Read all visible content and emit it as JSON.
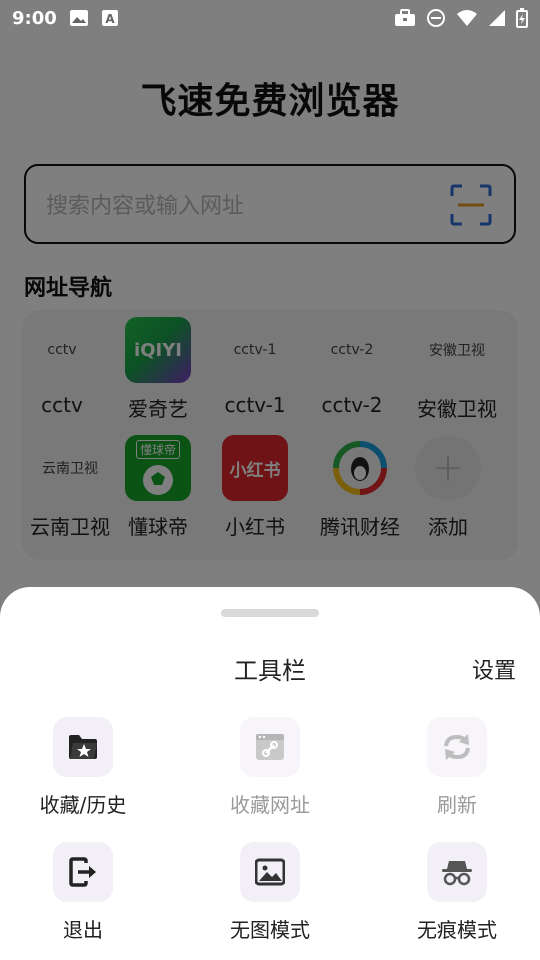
{
  "status_bar": {
    "time": "9:00"
  },
  "app_title": "飞速免费浏览器",
  "search": {
    "placeholder": "搜索内容或输入网址"
  },
  "nav": {
    "heading": "网址导航",
    "items": [
      {
        "label": "cctv",
        "thumb_text": "cctv"
      },
      {
        "label": "爱奇艺",
        "thumb_text": "iQIYI"
      },
      {
        "label": "cctv-1",
        "thumb_text": "cctv-1"
      },
      {
        "label": "cctv-2",
        "thumb_text": "cctv-2"
      },
      {
        "label": "安徽卫视",
        "thumb_text": "安徽卫视"
      },
      {
        "label": "云南卫视",
        "thumb_text": "云南卫视"
      },
      {
        "label": "懂球帝",
        "thumb_text": "懂球帝"
      },
      {
        "label": "小红书",
        "thumb_text": "小红书"
      },
      {
        "label": "腾讯财经",
        "thumb_text": ""
      },
      {
        "label": "添加",
        "thumb_text": "+"
      }
    ]
  },
  "sheet": {
    "title": "工具栏",
    "settings": "设置",
    "tools": [
      {
        "label": "收藏/历史",
        "icon": "folder-star-icon",
        "enabled": true
      },
      {
        "label": "收藏网址",
        "icon": "bookmark-link-icon",
        "enabled": false
      },
      {
        "label": "刷新",
        "icon": "refresh-icon",
        "enabled": false
      },
      {
        "label": "退出",
        "icon": "exit-icon",
        "enabled": true
      },
      {
        "label": "无图模式",
        "icon": "image-icon",
        "enabled": true
      },
      {
        "label": "无痕模式",
        "icon": "incognito-icon",
        "enabled": true
      }
    ]
  },
  "colors": {
    "iqiyi": "#1fc34a",
    "dongqiudi": "#16a52a",
    "xiaohongshu": "#e0262c",
    "icon_dark": "#222222",
    "icon_disabled": "#bdbdbd"
  }
}
